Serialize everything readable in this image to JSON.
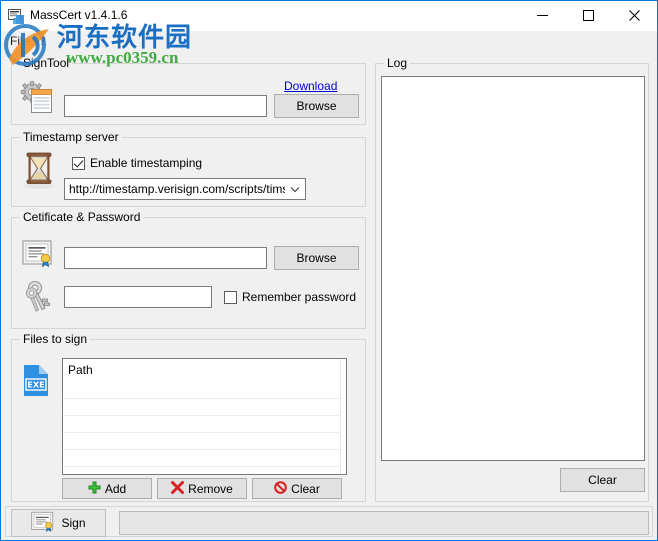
{
  "window": {
    "title": "MassCert v1.4.1.6",
    "icon": "certificate-icon",
    "minimize_label": "—",
    "maximize_label": "□",
    "close_label": "✕"
  },
  "menu": {
    "items": [
      {
        "label": "File",
        "name": "menu-file"
      },
      {
        "label": "?",
        "name": "menu-help"
      }
    ]
  },
  "watermark": {
    "site_name": "河东软件园",
    "site_url": "www.pc0359.cn",
    "color_cn": "#1a6fc4",
    "color_url": "#3faa3f"
  },
  "signtool": {
    "group_title": "SignTool",
    "icon": "gear-document-icon",
    "path_value": "",
    "path_placeholder": "",
    "download_link": "Download",
    "browse_label": "Browse"
  },
  "timestamp": {
    "group_title": "Timestamp server",
    "icon": "hourglass-icon",
    "enable_label": "Enable timestamping",
    "enable_checked": true,
    "server_selected": "http://timestamp.verisign.com/scripts/timstamp.dll"
  },
  "certificate": {
    "group_title": "Cetificate & Password",
    "cert_icon": "certificate-seal-icon",
    "key_icon": "keys-icon",
    "cert_value": "",
    "cert_placeholder": "",
    "browse_label": "Browse",
    "password_value": "",
    "password_placeholder": "",
    "remember_label": "Remember password",
    "remember_checked": false
  },
  "files": {
    "group_title": "Files to sign",
    "icon": "exe-file-icon",
    "column_header": "Path",
    "rows": [],
    "add_label": "Add",
    "remove_label": "Remove",
    "clear_label": "Clear"
  },
  "log": {
    "group_title": "Log",
    "content": "",
    "clear_label": "Clear"
  },
  "bottom": {
    "sign_label": "Sign",
    "sign_icon": "certificate-seal-icon",
    "progress_value": 0,
    "status_text": ""
  },
  "colors": {
    "accent": "#0078d7",
    "window_bg": "#f0f0f0",
    "field_bg": "#ffffff",
    "link": "#0000cc"
  }
}
